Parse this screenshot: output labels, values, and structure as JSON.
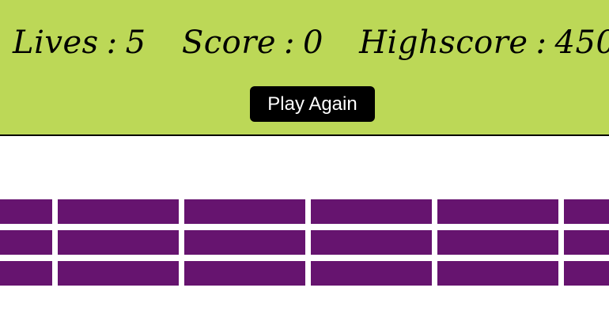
{
  "hud": {
    "lives_label": "Lives",
    "lives_value": "5",
    "score_label": "Score",
    "score_value": "0",
    "highscore_label": "Highscore",
    "highscore_value": "450",
    "separator": ":"
  },
  "actions": {
    "play_again_label": "Play Again"
  },
  "bricks": {
    "color": "#66146f",
    "rows": 3,
    "columns": 6
  },
  "colors": {
    "hud_background": "#bcd857",
    "button_background": "#000000",
    "button_text": "#ffffff"
  }
}
